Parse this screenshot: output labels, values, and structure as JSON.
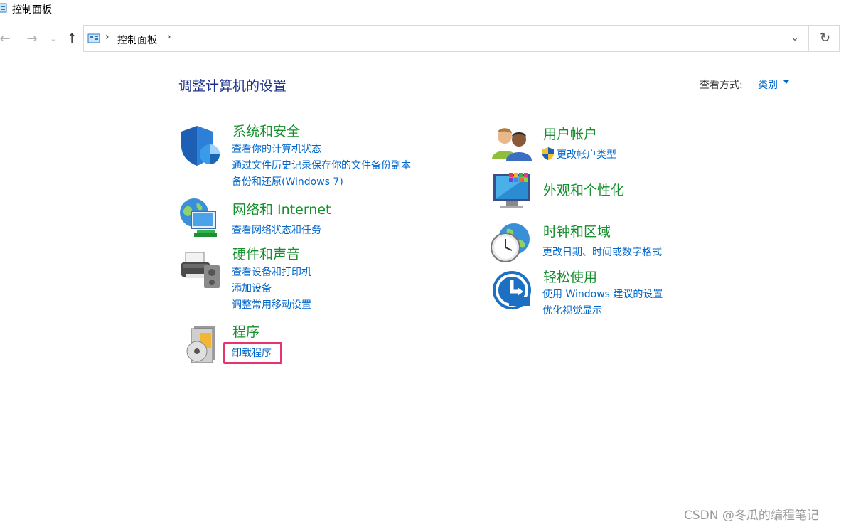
{
  "window": {
    "title": "控制面板"
  },
  "address_bar": {
    "crumbs": [
      "控制面板"
    ]
  },
  "header": {
    "title": "调整计算机的设置",
    "view_by_label": "查看方式:",
    "view_by_value": "类别"
  },
  "categories": {
    "system_security": {
      "title": "系统和安全",
      "links": [
        "查看你的计算机状态",
        "通过文件历史记录保存你的文件备份副本",
        "备份和还原(Windows 7)"
      ]
    },
    "network": {
      "title": "网络和 Internet",
      "links": [
        "查看网络状态和任务"
      ]
    },
    "hardware": {
      "title": "硬件和声音",
      "links": [
        "查看设备和打印机",
        "添加设备",
        "调整常用移动设置"
      ]
    },
    "programs": {
      "title": "程序",
      "links": [
        "卸载程序"
      ]
    },
    "user_accounts": {
      "title": "用户帐户",
      "links": [
        "更改帐户类型"
      ]
    },
    "appearance": {
      "title": "外观和个性化",
      "links": []
    },
    "clock_region": {
      "title": "时钟和区域",
      "links": [
        "更改日期、时间或数字格式"
      ]
    },
    "ease_of_access": {
      "title": "轻松使用",
      "links": [
        "使用 Windows 建议的设置",
        "优化视觉显示"
      ]
    }
  },
  "watermark": "CSDN @冬瓜的编程笔记",
  "colors": {
    "link": "#0066cc",
    "category": "#168f2d",
    "title": "#1e3287",
    "highlight": "#e8336e"
  }
}
